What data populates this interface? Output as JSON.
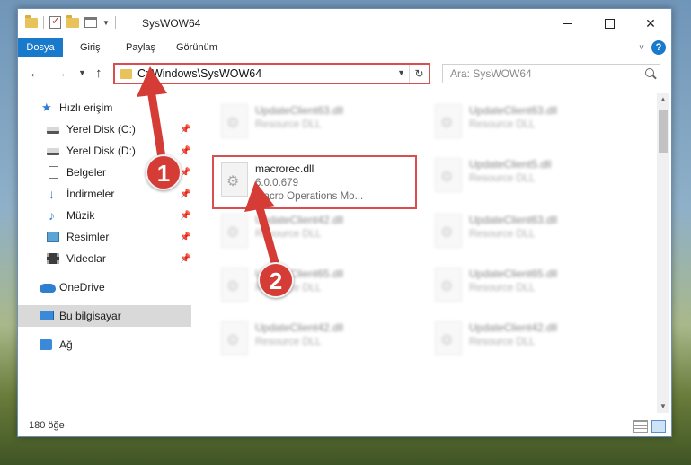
{
  "window": {
    "title": "SysWOW64",
    "caption": {
      "minimize": "",
      "maximize": "",
      "close": "✕"
    }
  },
  "ribbon": {
    "tabs": [
      "Dosya",
      "Giriş",
      "Paylaş",
      "Görünüm"
    ],
    "help": "?"
  },
  "address": {
    "path": "C:\\Windows\\SysWOW64",
    "refresh": "↻",
    "search_placeholder": "Ara: SysWOW64"
  },
  "navpane": {
    "items": [
      {
        "label": "Hızlı erişim",
        "icon": "star-icon",
        "pinned": false
      },
      {
        "label": "Yerel Disk (C:)",
        "icon": "drive-icon",
        "pinned": true
      },
      {
        "label": "Yerel Disk (D:)",
        "icon": "drive-icon",
        "pinned": true
      },
      {
        "label": "Belgeler",
        "icon": "document-icon",
        "pinned": true
      },
      {
        "label": "İndirmeler",
        "icon": "download-icon",
        "pinned": true
      },
      {
        "label": "Müzik",
        "icon": "music-icon",
        "pinned": true
      },
      {
        "label": "Resimler",
        "icon": "pictures-icon",
        "pinned": true
      },
      {
        "label": "Videolar",
        "icon": "video-icon",
        "pinned": true
      },
      {
        "label": "OneDrive",
        "icon": "cloud-icon",
        "pinned": false
      },
      {
        "label": "Bu bilgisayar",
        "icon": "computer-icon",
        "pinned": false,
        "selected": true
      },
      {
        "label": "Ağ",
        "icon": "network-icon",
        "pinned": false
      }
    ]
  },
  "files": {
    "left": [
      {
        "name": "UpdateClient63.dll",
        "type": "Resource DLL",
        "blurred": true
      },
      {
        "name": "macrorec.dll",
        "version": "6.0.0.679",
        "description": "Macro Operations Mo...",
        "blurred": false,
        "highlighted": true
      },
      {
        "name": "UpdateClient42.dll",
        "type": "Resource DLL",
        "blurred": true
      },
      {
        "name": "UpdateClient65.dll",
        "type": "Resource DLL",
        "blurred": true
      },
      {
        "name": "UpdateClient42.dll",
        "type": "Resource DLL",
        "blurred": true
      }
    ],
    "right": [
      {
        "name": "UpdateClient63.dll",
        "type": "Resource DLL"
      },
      {
        "name": "UpdateClient5.dll",
        "type": "Resource DLL"
      },
      {
        "name": "UpdateClient63.dll",
        "type": "Resource DLL"
      },
      {
        "name": "UpdateClient65.dll",
        "type": "Resource DLL"
      },
      {
        "name": "UpdateClient42.dll",
        "type": "Resource DLL"
      }
    ]
  },
  "status": {
    "count": "180 öğe"
  },
  "callouts": {
    "first": "1",
    "second": "2"
  },
  "colors": {
    "accent": "#1979ca",
    "highlight": "#d94f4f",
    "callout": "#d63c36"
  }
}
